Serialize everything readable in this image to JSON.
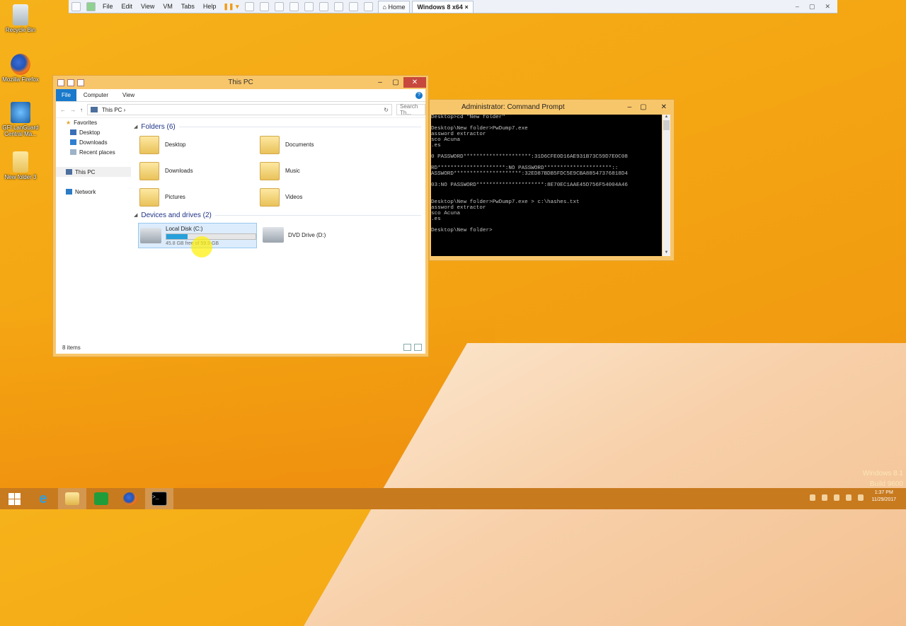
{
  "vm": {
    "menu": [
      "File",
      "Edit",
      "View",
      "VM",
      "Tabs",
      "Help"
    ],
    "tabs": [
      "Home",
      "Windows 8 x64"
    ],
    "tab_close": "×"
  },
  "desktop_icons": [
    "Recycle Bin",
    "Mozilla Firefox",
    "GFI LanGuard Central Ma...",
    "New folder 3"
  ],
  "explorer": {
    "title": "This PC",
    "ribbon": {
      "file": "File",
      "computer": "Computer",
      "view": "View"
    },
    "address": {
      "path": "This PC",
      "search_placeholder": "Search Th..."
    },
    "nav": {
      "favorites": "Favorites",
      "desktop": "Desktop",
      "downloads": "Downloads",
      "recent": "Recent places",
      "this_pc": "This PC",
      "network": "Network"
    },
    "folders_header": "Folders (6)",
    "folders": [
      "Desktop",
      "Documents",
      "Downloads",
      "Music",
      "Pictures",
      "Videos"
    ],
    "drives_header": "Devices and drives (2)",
    "drive_c": {
      "name": "Local Disk (C:)",
      "free": "45.8 GB free of 59.9 GB",
      "used_fraction": 0.235
    },
    "drive_d": {
      "name": "DVD Drive (D:)"
    },
    "status": "8 items"
  },
  "cmd": {
    "title": "Administrator: Command Prompt",
    "lines": [
      "Desktop>cd \"New folder\"",
      "",
      "Desktop\\New folder>PwDump7.exe",
      "assword extractor",
      "sco Acuna",
      ".es",
      "",
      "0 PASSWORD*********************:31D6CFE0D16AE931B73C59D7E0C08",
      "",
      "RD*********************:NO PASSWORD*********************::",
      "ASSWORD*********************:32ED87BDB5FDC5E9CBA88547376818D4",
      "",
      "03:NO PASSWORD*********************:8E70EC1AAE45D756F54004A46",
      "",
      "",
      "Desktop\\New folder>PwDump7.exe > c:\\hashes.txt",
      "assword extractor",
      "sco Acuna",
      ".es",
      "",
      "Desktop\\New folder>"
    ]
  },
  "tray": {
    "time": "1:37 PM",
    "date": "11/29/2017"
  },
  "watermark": {
    "line1": "Windows 8.1",
    "line2": "Build 9600"
  }
}
